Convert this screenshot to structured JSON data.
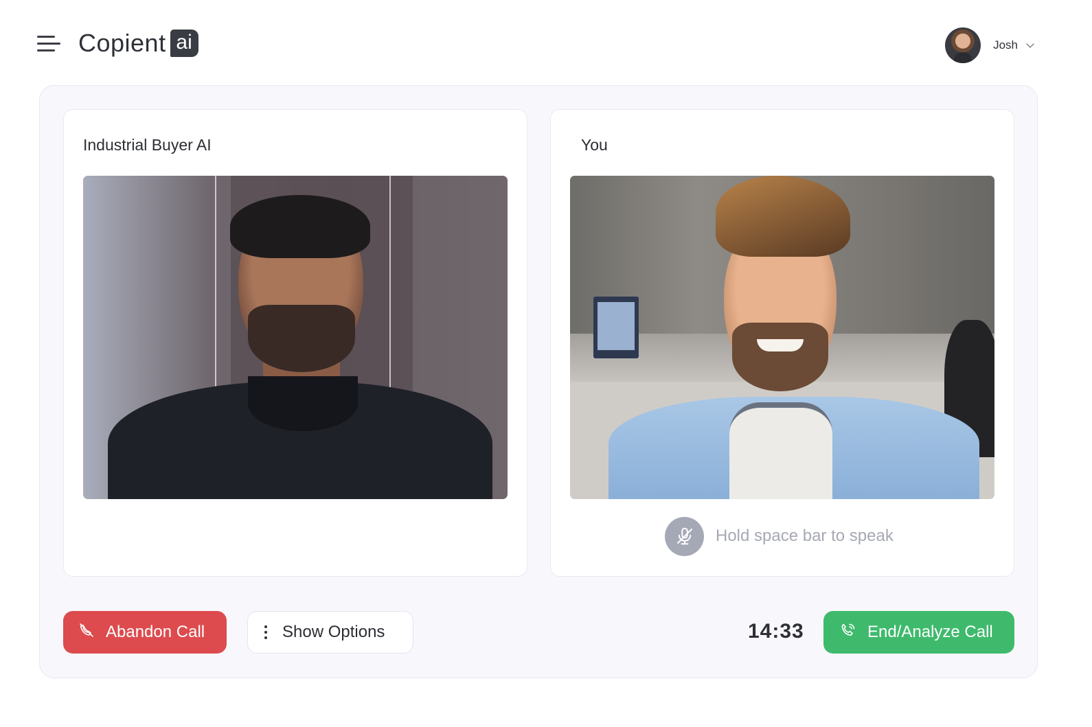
{
  "app": {
    "logo_text": "Copient",
    "logo_badge": "ai"
  },
  "user": {
    "name": "Josh"
  },
  "buyer_panel": {
    "title": "Industrial Buyer AI"
  },
  "you_panel": {
    "title": "You",
    "hint": "Hold space bar to speak"
  },
  "controls": {
    "abandon_label": "Abandon Call",
    "options_label": "Show Options",
    "end_label": "End/Analyze Call",
    "timer": "14:33"
  },
  "colors": {
    "abandon": "#dd4b4e",
    "end": "#3fba6c",
    "mic_muted": "#a5a9b6",
    "background": "#f8f8fc"
  },
  "icons": {
    "menu": "hamburger-icon",
    "user_menu": "chevron-down-icon",
    "mic": "mic-off-icon",
    "abandon": "phone-hangup-icon",
    "options": "kebab-icon",
    "end": "phone-call-icon"
  }
}
